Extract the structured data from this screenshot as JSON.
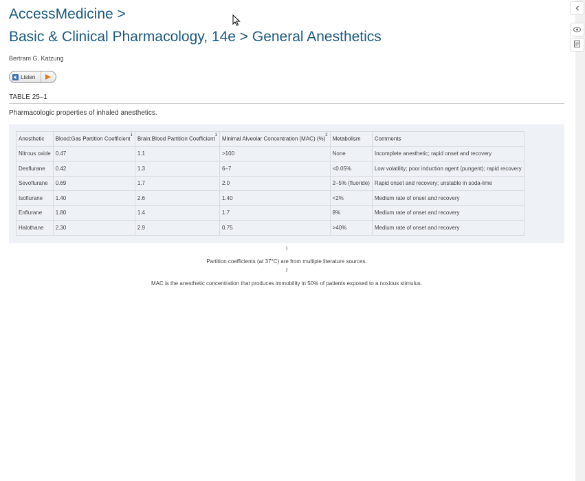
{
  "header": {
    "breadcrumb": "AccessMedicine >",
    "chapter": "Basic & Clinical Pharmacology, 14e > General Anesthetics",
    "author": "Bertram G. Katzung"
  },
  "listen": {
    "label": "Listen",
    "accent": "#e07a1a"
  },
  "table": {
    "label": "TABLE 25–1",
    "caption": "Pharmacologic properties of inhaled anesthetics.",
    "headers": [
      {
        "text": "Anesthetic",
        "sup": ""
      },
      {
        "text": "Blood:Gas Partition Coefficient",
        "sup": "1"
      },
      {
        "text": "Brain:Blood Partition Coefficient",
        "sup": "1"
      },
      {
        "text": "Minimal Alveolar Concentration (MAC) (%)",
        "sup": "2"
      },
      {
        "text": "Metabolism",
        "sup": ""
      },
      {
        "text": "Comments",
        "sup": ""
      }
    ],
    "rows": [
      [
        "Nitrous oxide",
        "0.47",
        "1.1",
        ">100",
        "None",
        "Incomplete anesthetic; rapid onset and recovery"
      ],
      [
        "Desflurane",
        "0.42",
        "1.3",
        "6–7",
        "<0.05%",
        "Low volatility; poor induction agent (pungent); rapid recovery"
      ],
      [
        "Sevoflurane",
        "0.69",
        "1.7",
        "2.0",
        "2–5% (fluoride)",
        "Rapid onset and recovery; unstable in soda-lime"
      ],
      [
        "Isoflurane",
        "1.40",
        "2.6",
        "1.40",
        "<2%",
        "Medium rate of onset and recovery"
      ],
      [
        "Enflurane",
        "1.80",
        "1.4",
        "1.7",
        "8%",
        "Medium rate of onset and recovery"
      ],
      [
        "Halothane",
        "2.30",
        "2.9",
        "0.75",
        ">40%",
        "Medium rate of onset and recovery"
      ]
    ]
  },
  "footnotes": [
    {
      "num": "1",
      "text": "Partition coefficients (at 37°C) are from multiple literature sources."
    },
    {
      "num": "2",
      "text": "MAC is the anesthetic concentration that produces immobility in 50% of patients exposed to a noxious stimulus."
    }
  ],
  "rail": {
    "icons": [
      "chevron-left-icon",
      "eye-icon",
      "notes-icon"
    ]
  }
}
